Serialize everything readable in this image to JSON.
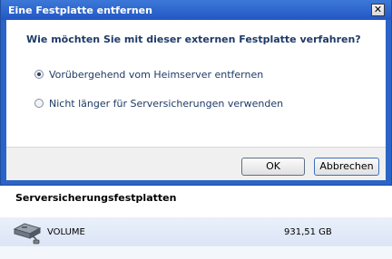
{
  "dialog": {
    "title": "Eine Festplatte entfernen",
    "close_symbol": "✕",
    "question": "Wie möchten Sie mit dieser externen Festplatte verfahren?",
    "options": [
      {
        "label": "Vorübergehend vom Heimserver entfernen",
        "selected": true
      },
      {
        "label": "Nicht länger für Serversicherungen verwenden",
        "selected": false
      }
    ],
    "ok_label": "OK",
    "cancel_label": "Abbrechen"
  },
  "background": {
    "section_title": "Serversicherungsfestplatten",
    "drives": [
      {
        "name": "VOLUME",
        "size": "931,51 GB",
        "icon": "hard-drive-icon"
      }
    ]
  },
  "colors": {
    "title_bar": "#2b64c6",
    "question_text": "#1e3a66",
    "row_highlight": "#dbe5f6"
  }
}
